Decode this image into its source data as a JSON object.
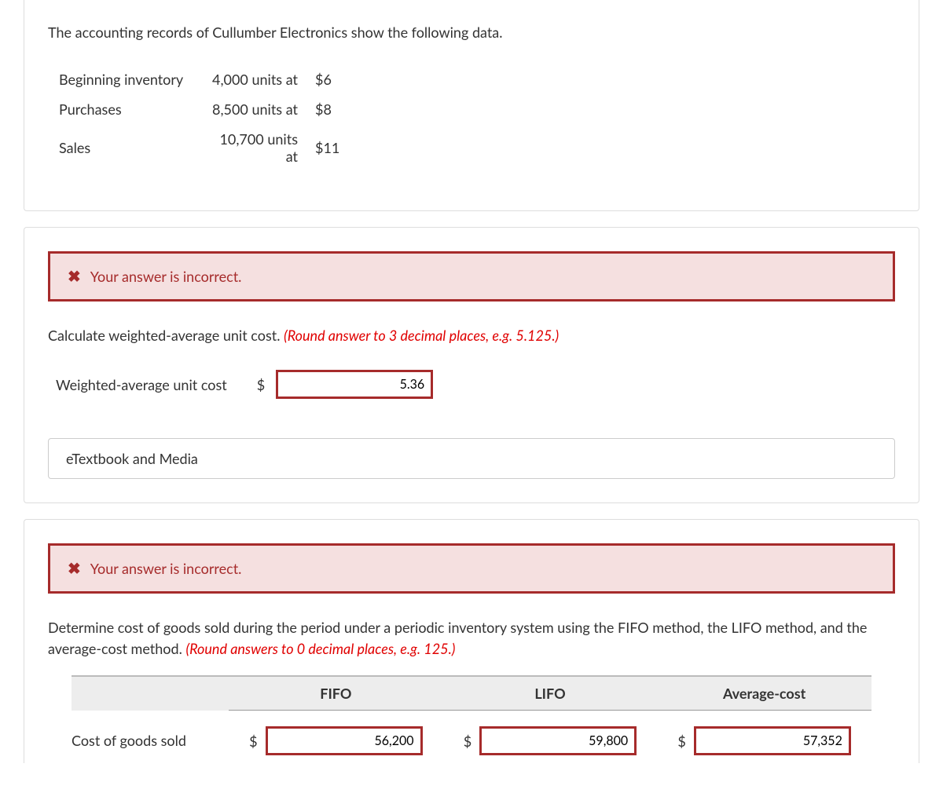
{
  "intro_text": "The accounting records of Cullumber Electronics show the following data.",
  "data_rows": [
    {
      "label": "Beginning inventory",
      "units": "4,000 units at",
      "price": "$6"
    },
    {
      "label": "Purchases",
      "units": "8,500 units at",
      "price": "$8"
    },
    {
      "label": "Sales",
      "units": "10,700 units at",
      "price": "$11"
    }
  ],
  "alert_text": "Your answer is incorrect.",
  "part1": {
    "prompt_plain": "Calculate weighted-average unit cost. ",
    "prompt_hint": "(Round answer to 3 decimal places, e.g. 5.125.)",
    "row_label": "Weighted-average unit cost",
    "currency": "$",
    "value": "5.36"
  },
  "etext_label": "eTextbook and Media",
  "part2": {
    "prompt_plain": "Determine cost of goods sold during the period under a periodic inventory system using the FIFO method, the LIFO method, and the average-cost method. ",
    "prompt_hint": "(Round answers to 0 decimal places, e.g. 125.)",
    "headers": {
      "fifo": "FIFO",
      "lifo": "LIFO",
      "avg": "Average-cost"
    },
    "row_label": "Cost of goods sold",
    "currency": "$",
    "values": {
      "fifo": "56,200",
      "lifo": "59,800",
      "avg": "57,352"
    }
  }
}
